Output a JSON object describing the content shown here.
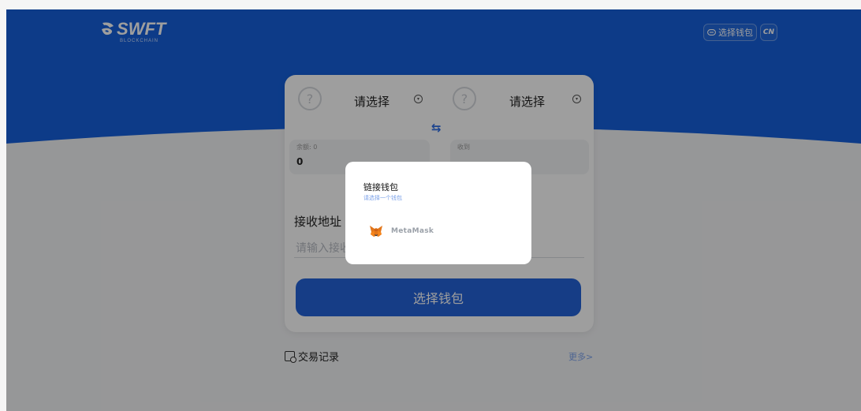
{
  "header": {
    "logo_text": "SWFT",
    "logo_sub": "BLOCKCHAIN",
    "wallet_button_label": "选择钱包",
    "lang_button_label": "CN"
  },
  "swap_card": {
    "from_token": {
      "icon": "?",
      "label": "请选择"
    },
    "to_token": {
      "icon": "?",
      "label": "请选择"
    },
    "balance_label": "余额: 0",
    "from_amount": "0",
    "receive_label": "收到",
    "address_title": "接收地址",
    "address_placeholder": "请输入接收",
    "select_wallet_button": "选择钱包"
  },
  "records": {
    "label": "交易记录",
    "more_label": "更多>"
  },
  "modal": {
    "title": "链接钱包",
    "subtitle": "请选择一个钱包",
    "wallets": [
      {
        "name": "MetaMask",
        "icon": "metamask-fox-icon"
      }
    ]
  },
  "colors": {
    "hero_blue": "#1560dc",
    "button_blue": "#2563d8",
    "overlay": "rgba(0,0,0,0.38)"
  }
}
